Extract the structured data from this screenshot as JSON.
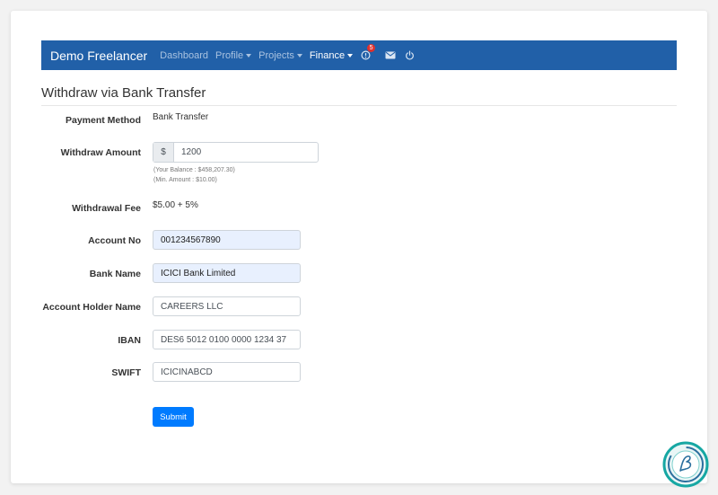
{
  "navbar": {
    "brand": "Demo Freelancer",
    "items": [
      {
        "label": "Dashboard"
      },
      {
        "label": "Profile"
      },
      {
        "label": "Projects"
      },
      {
        "label": "Finance"
      }
    ],
    "notification_count": "5",
    "icons": [
      "alert-circle-icon",
      "mail-icon",
      "power-icon"
    ]
  },
  "page": {
    "title": "Withdraw via Bank Transfer"
  },
  "form": {
    "payment_method": {
      "label": "Payment Method",
      "value": "Bank Transfer"
    },
    "withdraw_amount": {
      "label": "Withdraw Amount",
      "currency": "$",
      "value": "1200",
      "balance_note": "(Your Balance : $458,207.30)",
      "min_note": "(Min. Amount : $10.00)"
    },
    "withdrawal_fee": {
      "label": "Withdrawal Fee",
      "value": "$5.00 + 5%"
    },
    "account_no": {
      "label": "Account No",
      "value": "001234567890"
    },
    "bank_name": {
      "label": "Bank Name",
      "value": "ICICI Bank Limited"
    },
    "account_holder": {
      "label": "Account Holder Name",
      "value": "CAREERS LLC"
    },
    "iban": {
      "label": "IBAN",
      "value": "DES6 5012 0100 0000 1234 37"
    },
    "swift": {
      "label": "SWIFT",
      "value": "ICICINABCD"
    },
    "submit_label": "Submit"
  },
  "colors": {
    "navbar": "#2160a8",
    "primary_button": "#007bff",
    "badge": "#e0312e",
    "autofill": "#e8f0fe"
  }
}
